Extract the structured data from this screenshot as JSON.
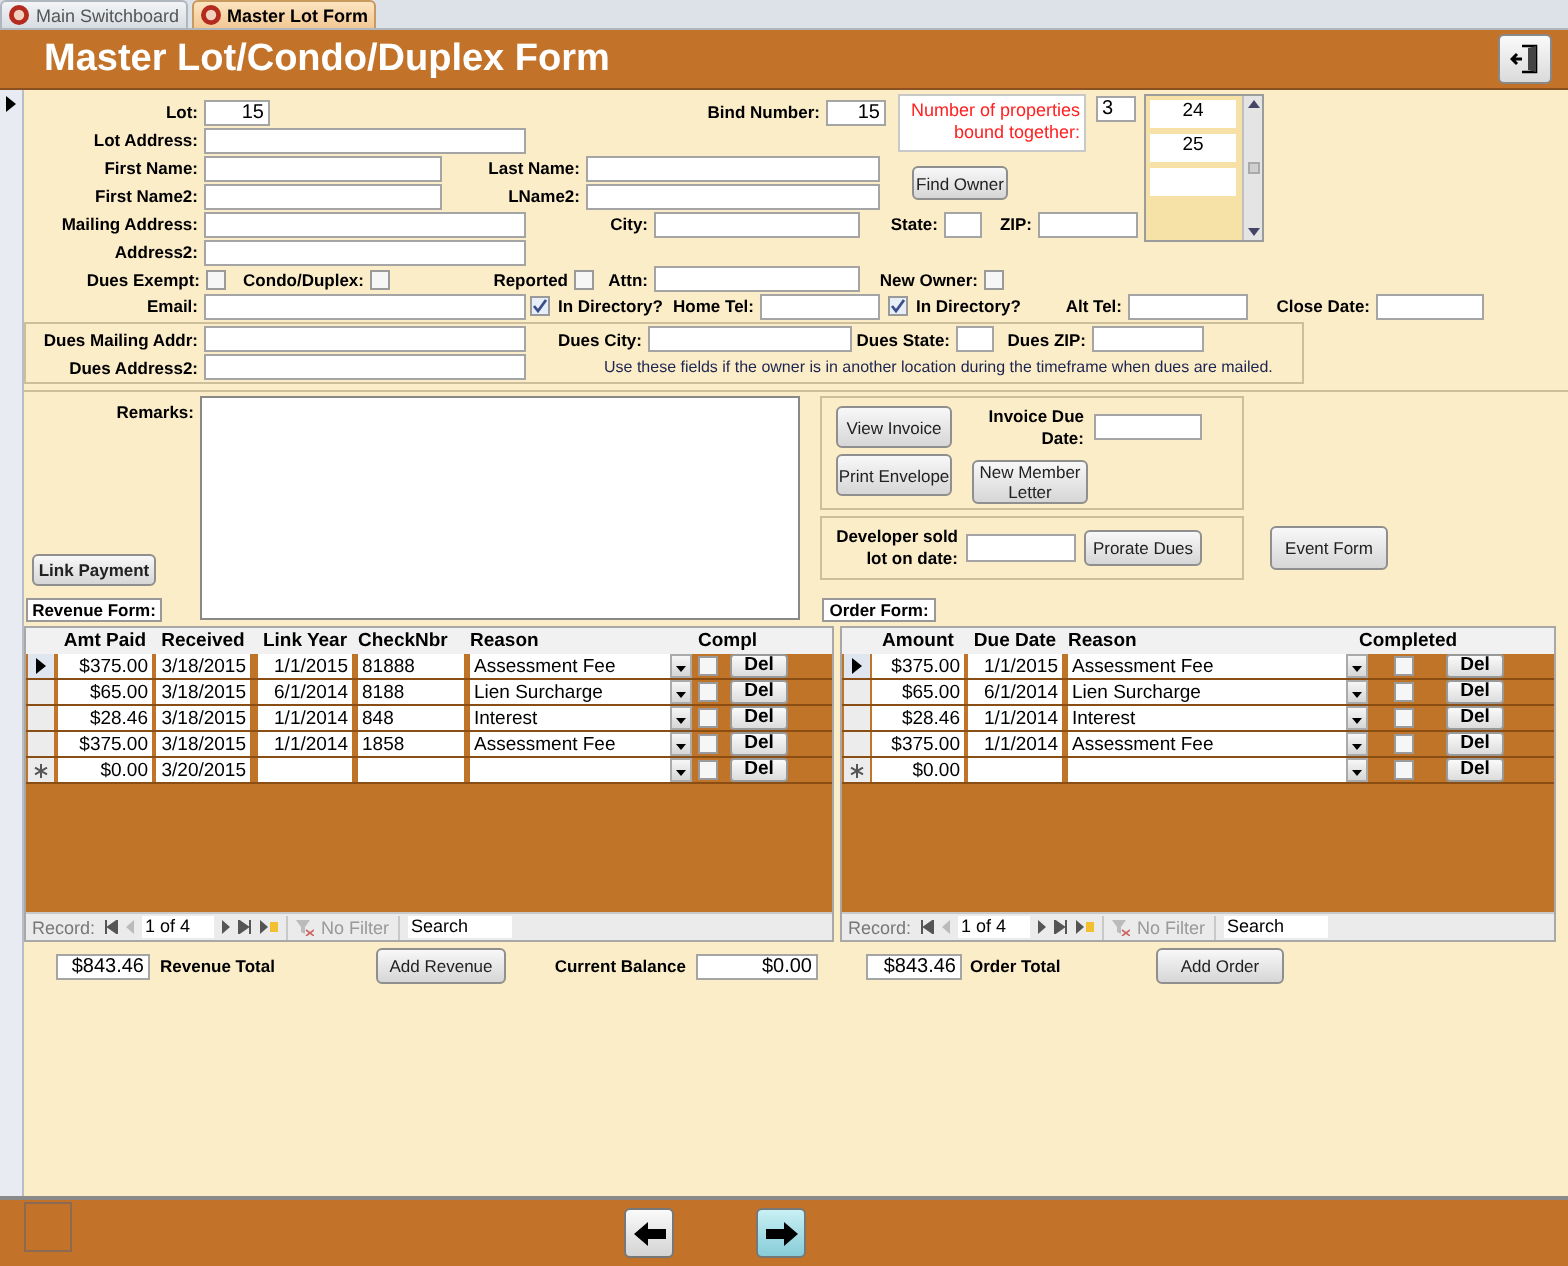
{
  "tabs": [
    {
      "label": "Main Switchboard",
      "selected": false
    },
    {
      "label": "Master Lot Form",
      "selected": true
    }
  ],
  "title": "Master Lot/Condo/Duplex Form",
  "lot": {
    "label": "Lot:",
    "value": "15"
  },
  "bind_number": {
    "label": "Bind Number:",
    "value": "15"
  },
  "bound_note": "Number of properties bound together:",
  "bound_count": "3",
  "bound_lots": [
    "24",
    "25"
  ],
  "lot_address": {
    "label": "Lot Address:"
  },
  "first_name": {
    "label": "First Name:"
  },
  "last_name": {
    "label": "Last Name:"
  },
  "first_name2": {
    "label": "First Name2:"
  },
  "lname2": {
    "label": "LName2:"
  },
  "find_owner": "Find Owner",
  "mailing_address": {
    "label": "Mailing Address:"
  },
  "city": {
    "label": "City:"
  },
  "state": {
    "label": "State:"
  },
  "zip": {
    "label": "ZIP:"
  },
  "address2": {
    "label": "Address2:"
  },
  "dues_exempt": {
    "label": "Dues Exempt:",
    "checked": false
  },
  "condo_duplex": {
    "label": "Condo/Duplex:",
    "checked": false
  },
  "reported": {
    "label": "Reported",
    "checked": false
  },
  "attn": {
    "label": "Attn:"
  },
  "new_owner": {
    "label": "New Owner:",
    "checked": false
  },
  "email": {
    "label": "Email:"
  },
  "email_in_directory": {
    "label": "In Directory?",
    "checked": true
  },
  "home_tel": {
    "label": "Home Tel:"
  },
  "home_tel_in_directory": {
    "label": "In Directory?",
    "checked": true
  },
  "alt_tel": {
    "label": "Alt Tel:"
  },
  "close_date": {
    "label": "Close Date:"
  },
  "dues_mailing_addr": {
    "label": "Dues Mailing Addr:"
  },
  "dues_city": {
    "label": "Dues City:"
  },
  "dues_state": {
    "label": "Dues State:"
  },
  "dues_zip": {
    "label": "Dues ZIP:"
  },
  "dues_address2": {
    "label": "Dues Address2:"
  },
  "dues_note": "Use these fields if the owner is in another location during the timeframe when dues are mailed.",
  "remarks": {
    "label": "Remarks:"
  },
  "link_payment": "Link Payment",
  "view_invoice": "View Invoice",
  "invoice_due_date": {
    "label": "Invoice Due Date:"
  },
  "print_envelope": "Print Envelope",
  "new_member_letter": "New Member Letter",
  "developer_sold": {
    "label": "Developer sold lot on date:"
  },
  "prorate_dues": "Prorate Dues",
  "event_form": "Event Form",
  "revenue": {
    "title": "Revenue Form:",
    "columns": [
      "Amt Paid",
      "Received",
      "Link Year",
      "CheckNbr",
      "Reason",
      "Compl"
    ],
    "rows": [
      {
        "kind": "record",
        "selected": true,
        "amt_paid": "$375.00",
        "received": "3/18/2015",
        "link_year": "1/1/2015",
        "check_nbr": "81888",
        "reason": "Assessment Fee",
        "completed": false,
        "button": "Del"
      },
      {
        "kind": "record",
        "selected": false,
        "amt_paid": "$65.00",
        "received": "3/18/2015",
        "link_year": "6/1/2014",
        "check_nbr": "8188",
        "reason": "Lien Surcharge",
        "completed": false,
        "button": "Del"
      },
      {
        "kind": "record",
        "selected": false,
        "amt_paid": "$28.46",
        "received": "3/18/2015",
        "link_year": "1/1/2014",
        "check_nbr": "848",
        "reason": "Interest",
        "completed": false,
        "button": "Del"
      },
      {
        "kind": "record",
        "selected": false,
        "amt_paid": "$375.00",
        "received": "3/18/2015",
        "link_year": "1/1/2014",
        "check_nbr": "1858",
        "reason": "Assessment Fee",
        "completed": false,
        "button": "Del"
      },
      {
        "kind": "new",
        "selected": false,
        "amt_paid": "$0.00",
        "received": "3/20/2015",
        "completed": false,
        "button": "Del"
      }
    ],
    "nav": {
      "label": "Record:",
      "position": "1 of 4",
      "filter": "No Filter",
      "search": "Search"
    }
  },
  "order": {
    "title": "Order Form:",
    "columns": [
      "Amount",
      "Due Date",
      "Reason",
      "Completed"
    ],
    "rows": [
      {
        "kind": "record",
        "selected": true,
        "amount": "$375.00",
        "due_date": "1/1/2015",
        "reason": "Assessment Fee",
        "completed": false,
        "button": "Del"
      },
      {
        "kind": "record",
        "selected": false,
        "amount": "$65.00",
        "due_date": "6/1/2014",
        "reason": "Lien Surcharge",
        "completed": false,
        "button": "Del"
      },
      {
        "kind": "record",
        "selected": false,
        "amount": "$28.46",
        "due_date": "1/1/2014",
        "reason": "Interest",
        "completed": false,
        "button": "Del"
      },
      {
        "kind": "record",
        "selected": false,
        "amount": "$375.00",
        "due_date": "1/1/2014",
        "reason": "Assessment Fee",
        "completed": false,
        "button": "Del"
      },
      {
        "kind": "new",
        "selected": false,
        "amount": "$0.00",
        "completed": false,
        "button": "Del"
      }
    ],
    "nav": {
      "label": "Record:",
      "position": "1 of 4",
      "filter": "No Filter",
      "search": "Search"
    }
  },
  "revenue_total": {
    "label": "Revenue Total",
    "value": "$843.46"
  },
  "add_revenue": "Add Revenue",
  "current_balance": {
    "label": "Current Balance",
    "value": "$0.00"
  },
  "order_total": {
    "label": "Order Total",
    "value": "$843.46"
  },
  "add_order": "Add Order"
}
